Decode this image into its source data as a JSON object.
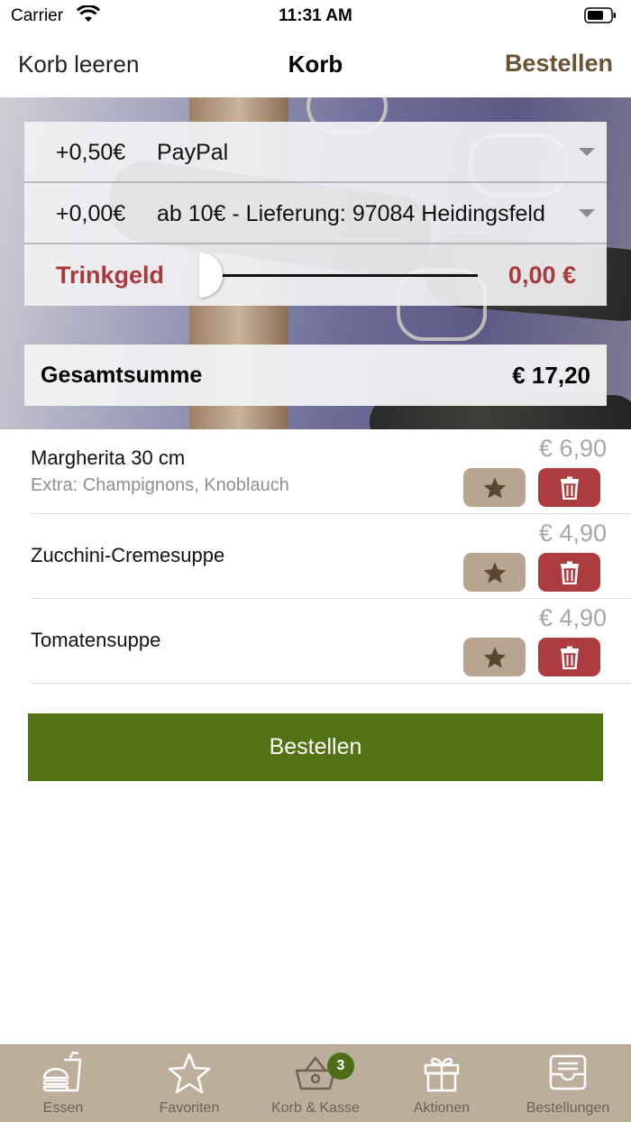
{
  "status_bar": {
    "carrier": "Carrier",
    "time": "11:31 AM"
  },
  "nav": {
    "left_label": "Korb leeren",
    "title": "Korb",
    "right_label": "Bestellen"
  },
  "options": {
    "payment": {
      "fee": "+0,50€",
      "label": "PayPal"
    },
    "delivery": {
      "fee": "+0,00€",
      "label": "ab 10€ - Lieferung: 97084 Heidingsfeld"
    },
    "tip": {
      "label": "Trinkgeld",
      "value": "0,00 €",
      "slider_level": 0
    }
  },
  "total": {
    "label": "Gesamtsumme",
    "value": "€ 17,20"
  },
  "items": [
    {
      "name": "Margherita 30 cm",
      "extra": "Extra: Champignons, Knoblauch",
      "price": "€ 6,90"
    },
    {
      "name": "Zucchini-Cremesuppe",
      "extra": "",
      "price": "€ 4,90"
    },
    {
      "name": "Tomatensuppe",
      "extra": "",
      "price": "€ 4,90"
    }
  ],
  "order_button": "Bestellen",
  "tabs": [
    {
      "label": "Essen",
      "icon": "food-icon"
    },
    {
      "label": "Favoriten",
      "icon": "star-icon"
    },
    {
      "label": "Korb & Kasse",
      "icon": "basket-icon",
      "badge": "3"
    },
    {
      "label": "Aktionen",
      "icon": "gift-icon"
    },
    {
      "label": "Bestellungen",
      "icon": "inbox-icon"
    }
  ],
  "colors": {
    "accent_brown": "#6b5232",
    "tip_red": "#a9393a",
    "order_green": "#527213",
    "tab_bar": "#bdae9b",
    "delete_red": "#ad3c40",
    "fav_tan": "#b7a591"
  }
}
